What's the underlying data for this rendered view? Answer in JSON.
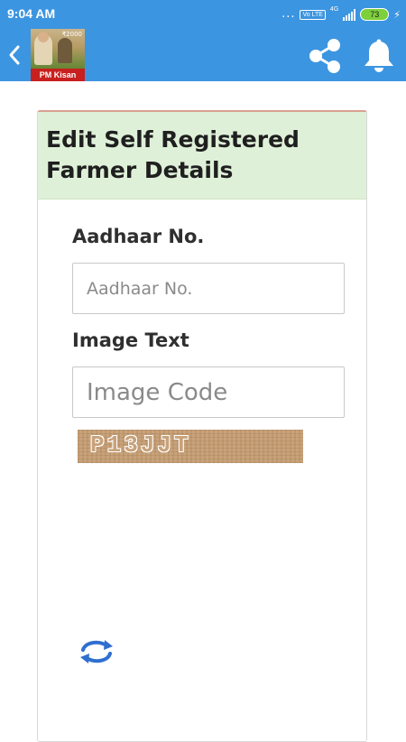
{
  "status_bar": {
    "time": "9:04 AM",
    "dots": "...",
    "volte": "Vo LTE",
    "network": "4G",
    "battery": "73",
    "icons": [
      "signal-icon",
      "battery-icon",
      "charging-icon"
    ]
  },
  "app_bar": {
    "logo_label": "PM Kisan",
    "logo_amount": "₹2000",
    "icons": [
      "back-icon",
      "share-icon",
      "bell-icon"
    ],
    "color": "#3c95e0"
  },
  "form": {
    "title": "Edit Self Registered Farmer Details",
    "header_color": "#dff0d8",
    "aadhaar_label": "Aadhaar No.",
    "aadhaar_placeholder": "Aadhaar No.",
    "aadhaar_value": "",
    "image_text_label": "Image Text",
    "image_code_placeholder": "Image Code",
    "image_code_value": "",
    "captcha_text": "P13JJT",
    "refresh_icon": "refresh-icon"
  }
}
